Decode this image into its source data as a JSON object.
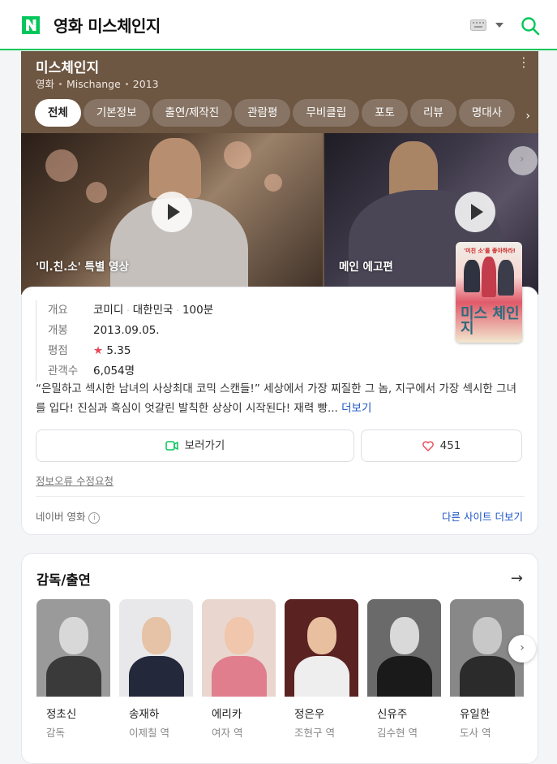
{
  "header": {
    "logo_letter": "N",
    "query": "영화 미스체인지",
    "brand_color": "#03c75a"
  },
  "hero": {
    "title": "미스체인지",
    "meta": [
      "영화",
      "Mischange",
      "2013"
    ],
    "tabs": [
      "전체",
      "기본정보",
      "출연/제작진",
      "관람평",
      "무비클립",
      "포토",
      "리뷰",
      "명대사"
    ],
    "active_tab": "전체",
    "videos": [
      {
        "label": "'미.친.소' 특별 영상"
      },
      {
        "label": "메인 에고편"
      }
    ]
  },
  "poster": {
    "top_text": "'미친 소'를 좋아하라!",
    "title_text": "미스 체인지"
  },
  "info": {
    "facts": [
      {
        "key": "개요",
        "values": [
          "코미디",
          "대한민국",
          "100분"
        ]
      },
      {
        "key": "개봉",
        "values": [
          "2013.09.05."
        ]
      },
      {
        "key": "평점",
        "values": [
          "5.35"
        ]
      },
      {
        "key": "관객수",
        "values": [
          "6,054명"
        ]
      }
    ],
    "star": "★",
    "synopsis": "“은밀하고 섹시한 남녀의 사상최대 코믹 스캔들!” 세상에서 가장 찌질한 그 놈, 지구에서 가장 섹시한 그녀를 입다! 진심과 흑심이 엇갈린 발칙한 상상이 시작된다! 재력 빵...",
    "more_label": "더보기",
    "watch_label": "보러가기",
    "like_count": "451",
    "report_label": "정보오류 수정요청",
    "source_label": "네이버 영화",
    "info_icon": "i",
    "other_sites_label": "다른 사이트 더보기"
  },
  "cast": {
    "heading": "감독/출연",
    "arrow": "→",
    "members": [
      {
        "name": "정초신",
        "role": "감독",
        "bg": "#9a9a9a",
        "skin": "#d8d8d8",
        "cloth": "#3a3a3a"
      },
      {
        "name": "송재하",
        "role": "이제칠 역",
        "bg": "#e8e8ea",
        "skin": "#e6c3a6",
        "cloth": "#23283a"
      },
      {
        "name": "에리카",
        "role": "여자 역",
        "bg": "#e9d7cf",
        "skin": "#f0c6ad",
        "cloth": "#e07e8e"
      },
      {
        "name": "정은우",
        "role": "조현구 역",
        "bg": "#5b2222",
        "skin": "#e8c0a0",
        "cloth": "#eeeeee"
      },
      {
        "name": "신유주",
        "role": "김수현 역",
        "bg": "#6a6a6a",
        "skin": "#d9d9d9",
        "cloth": "#1a1a1a"
      },
      {
        "name": "유일한",
        "role": "도사 역",
        "bg": "#888888",
        "skin": "#c8c8c8",
        "cloth": "#2b2b2b"
      }
    ]
  }
}
